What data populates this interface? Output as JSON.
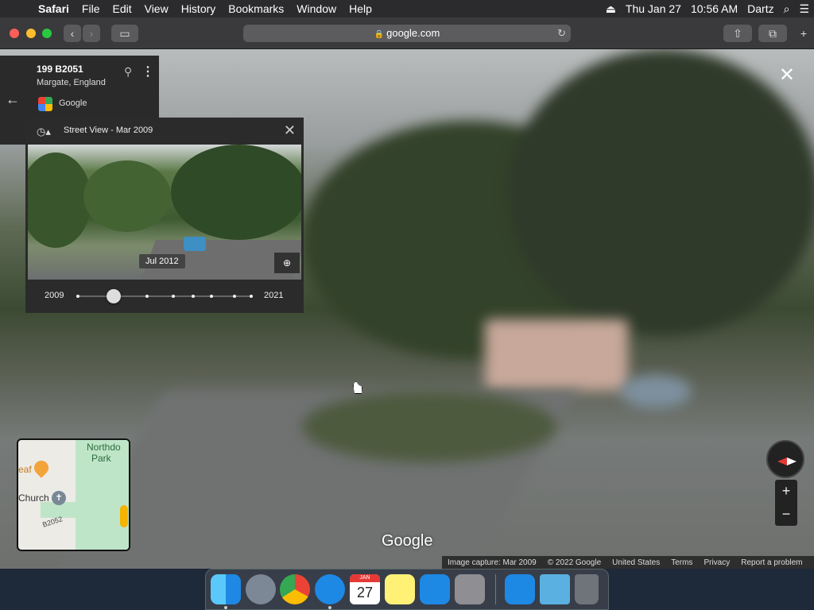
{
  "menubar": {
    "apple": "",
    "items": [
      "Safari",
      "File",
      "Edit",
      "View",
      "History",
      "Bookmarks",
      "Window",
      "Help"
    ],
    "date": "Thu Jan 27",
    "time": "10:56 AM",
    "user": "Dartz"
  },
  "browser": {
    "url": "google.com"
  },
  "place": {
    "title": "199 B2051",
    "subtitle": "Margate, England",
    "source": "Google"
  },
  "timeline": {
    "header": "Street View - Mar 2009",
    "preview_date": "Jul 2012",
    "start_year": "2009",
    "end_year": "2021"
  },
  "minimap": {
    "park_label_1": "Northdo",
    "park_label_2": "Park",
    "poi_label": "eaf",
    "church_label": "Church",
    "road_label": "B2052"
  },
  "viewer": {
    "watermark": "Google",
    "footer": [
      "Image capture: Mar 2009",
      "© 2022 Google",
      "United States",
      "Terms",
      "Privacy",
      "Report a problem"
    ]
  },
  "dock": {
    "calendar_month": "JAN",
    "calendar_day": "27"
  }
}
